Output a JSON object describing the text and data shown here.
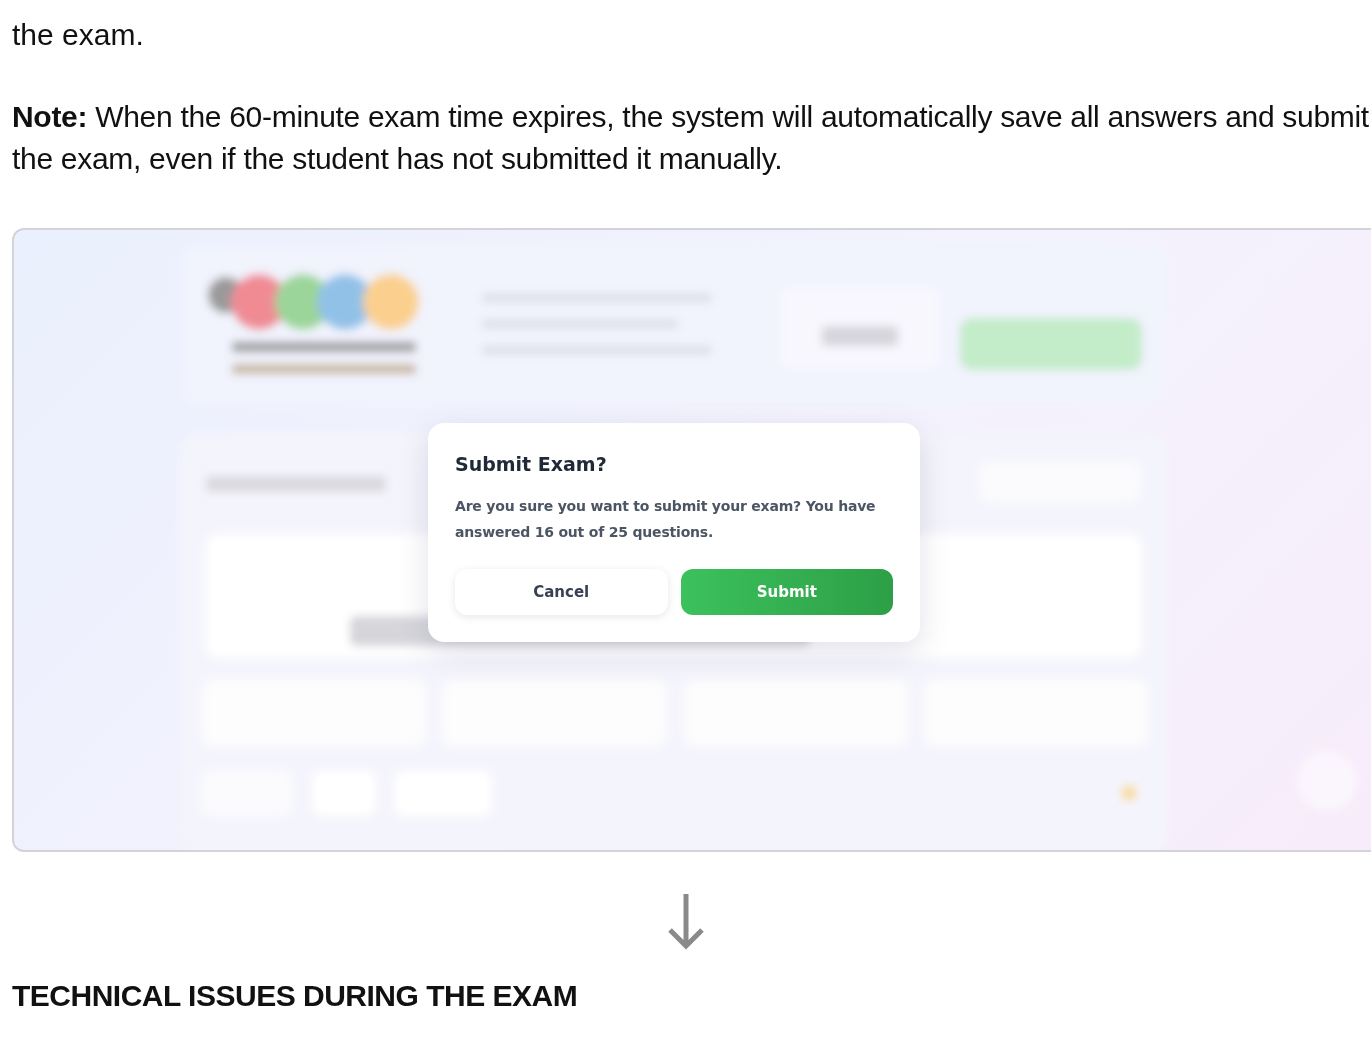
{
  "intro_tail": "the exam.",
  "note": "**Note:** When the 60-minute exam time expires, the system will automatically save all answers and submit the exam, even if the student has not submitted it manually.",
  "screenshot": {
    "dialog": {
      "title": "Submit Exam?",
      "message": "Are you sure you want to submit your exam? You have answered 16 out of 25 questions.",
      "buttons": [
        {
          "label": "Cancel",
          "kind": "secondary"
        },
        {
          "label": "Submit",
          "kind": "primary"
        }
      ]
    }
  },
  "next_heading": "TECHNICAL ISSUES DURING THE EXAM"
}
